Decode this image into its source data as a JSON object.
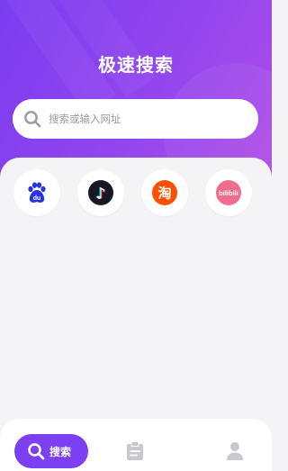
{
  "header": {
    "title": "极速搜索"
  },
  "search": {
    "placeholder": "搜索或输入网址"
  },
  "shortcuts": [
    {
      "name": "baidu",
      "icon": "baidu-icon",
      "glyph": "du"
    },
    {
      "name": "douyin",
      "icon": "douyin-icon",
      "glyph": "♪"
    },
    {
      "name": "taobao",
      "icon": "taobao-icon",
      "glyph": "淘"
    },
    {
      "name": "bilibili",
      "icon": "bilibili-icon",
      "glyph": "bilibili"
    }
  ],
  "tabbar": {
    "search_label": "搜索",
    "items": [
      "search-icon",
      "history-icon",
      "profile-icon"
    ]
  },
  "colors": {
    "accent": "#7c3ff1",
    "hero_start": "#7a3cf0",
    "hero_end": "#b04ce6",
    "baidu": "#2932e1",
    "taobao": "#ff5000",
    "bilibili": "#f06e8c",
    "douyin": "#161823"
  }
}
